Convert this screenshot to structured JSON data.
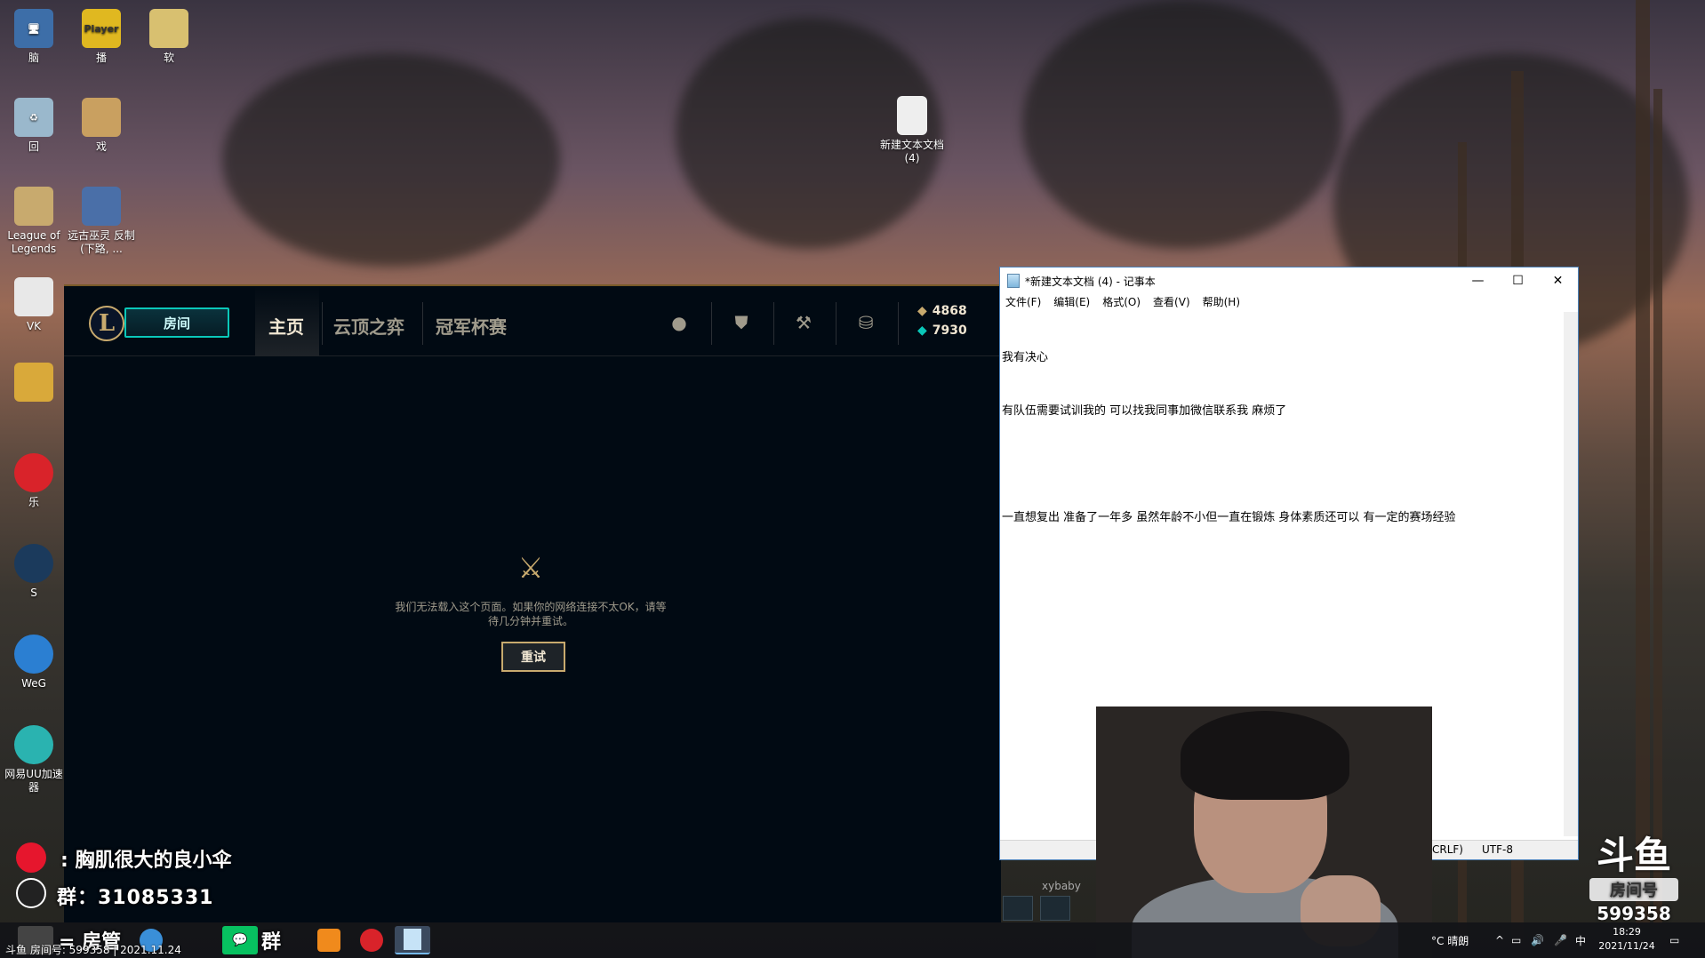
{
  "desktop": {
    "icons": [
      {
        "label": "脑"
      },
      {
        "label": "Player",
        "caption": "播"
      },
      {
        "label": "软"
      },
      {
        "label": "回"
      },
      {
        "label": "戏"
      },
      {
        "label": "League of Legends"
      },
      {
        "label": "远古巫灵 反制 (下路, ..."
      },
      {
        "label": "VK"
      },
      {
        "label": "乐"
      },
      {
        "label": "S"
      },
      {
        "label": "WeG"
      },
      {
        "label": "网易UU加速器"
      },
      {
        "label": "新建文本文档 (4)"
      }
    ]
  },
  "lol": {
    "play_label": "房间",
    "tabs": [
      {
        "label": "主页"
      },
      {
        "label": "云顶之弈"
      },
      {
        "label": "冠军杯赛"
      }
    ],
    "currency": {
      "blue_essence": "4868",
      "rp": "7930"
    },
    "error_text": "我们无法载入这个页面。如果你的网络连接不太OK，请等待几分钟并重试。",
    "retry_label": "重试",
    "nav_icons": [
      "profile-icon",
      "collection-icon",
      "loot-icon",
      "store-icon"
    ]
  },
  "notepad": {
    "title": "*新建文本文档 (4) - 记事本",
    "menu": [
      "文件(F)",
      "编辑(E)",
      "格式(O)",
      "查看(V)",
      "帮助(H)"
    ],
    "lines": [
      "我有决心",
      "有队伍需要试训我的 可以找我同事加微信联系我 麻烦了",
      "",
      "一直想复出 准备了一年多 虽然年龄不小但一直在锻炼 身体素质还可以 有一定的赛场经验"
    ],
    "status_crlf": "CRLF)",
    "status_encoding": "UTF-8"
  },
  "stream_overlay": {
    "text1": "胸肌很大的良小伞",
    "text2": "群：31085331",
    "text3": "房管",
    "text4": "群",
    "douyu_logo": "斗鱼",
    "douyu_room_label": "房间号",
    "douyu_room_number": "599358",
    "watermark": "斗鱼 房间号: 599358 | 2021.11.24",
    "chat_user": "xybaby"
  },
  "taskbar": {
    "weather": "°C 晴朗",
    "ime": "中",
    "time": "18:29",
    "date": "2021/11/24"
  }
}
